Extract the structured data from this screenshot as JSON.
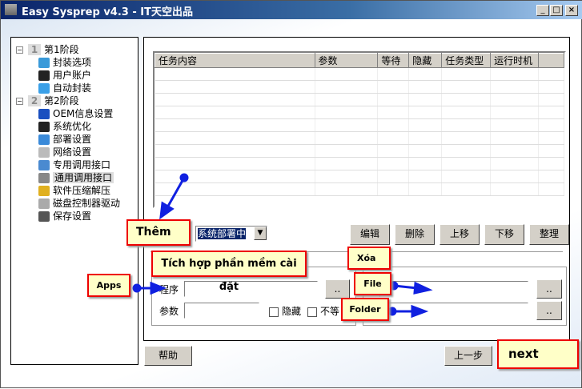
{
  "window": {
    "title": "Easy Sysprep v4.3 - IT天空出品",
    "minimize": "_",
    "maximize": "□",
    "close": "×"
  },
  "tree": [
    {
      "label": "第1阶段",
      "num": "1",
      "level": 0
    },
    {
      "label": "封装选项",
      "level": 1,
      "icon": "monitor-icon",
      "color": "#3a9ad9"
    },
    {
      "label": "用户账户",
      "level": 1,
      "icon": "user-icon",
      "color": "#222"
    },
    {
      "label": "自动封装",
      "level": 1,
      "icon": "arrow-right-icon",
      "color": "#3aa0e8"
    },
    {
      "label": "第2阶段",
      "num": "2",
      "level": 0
    },
    {
      "label": "OEM信息设置",
      "level": 1,
      "icon": "info-icon",
      "color": "#1a4fc0"
    },
    {
      "label": "系统优化",
      "level": 1,
      "icon": "gear-icon",
      "color": "#222"
    },
    {
      "label": "部署设置",
      "level": 1,
      "icon": "deploy-icon",
      "color": "#3a8ad9"
    },
    {
      "label": "网络设置",
      "level": 1,
      "icon": "network-icon",
      "color": "#bbb"
    },
    {
      "label": "专用调用接口",
      "level": 1,
      "icon": "interface-icon",
      "color": "#4a8ad0"
    },
    {
      "label": "通用调用接口",
      "level": 1,
      "icon": "interface-icon",
      "color": "#888",
      "selected": true
    },
    {
      "label": "软件压缩解压",
      "level": 1,
      "icon": "archive-icon",
      "color": "#e0b020"
    },
    {
      "label": "磁盘控制器驱动",
      "level": 1,
      "icon": "disk-icon",
      "color": "#aaa"
    },
    {
      "label": "保存设置",
      "level": 1,
      "icon": "save-icon",
      "color": "#555"
    }
  ],
  "table": {
    "columns": [
      "任务内容",
      "参数",
      "等待",
      "隐藏",
      "任务类型",
      "运行时机",
      ""
    ]
  },
  "combo": {
    "value": "系统部署中"
  },
  "buttons": {
    "edit": "编辑",
    "delete": "删除",
    "up": "上移",
    "down": "下移",
    "arrange": "整理",
    "browse": "..",
    "help": "帮助",
    "back": "上一步"
  },
  "form": {
    "program_label": "程序",
    "params_label": "参数",
    "hide_label": "隐藏",
    "nowait_label": "不等"
  },
  "annotations": {
    "add": "Thêm",
    "integrate": "Tích hợp phần mềm cài đặt",
    "remove": "Xóa",
    "apps": "Apps",
    "file": "File",
    "folder": "Folder",
    "next": "next"
  }
}
